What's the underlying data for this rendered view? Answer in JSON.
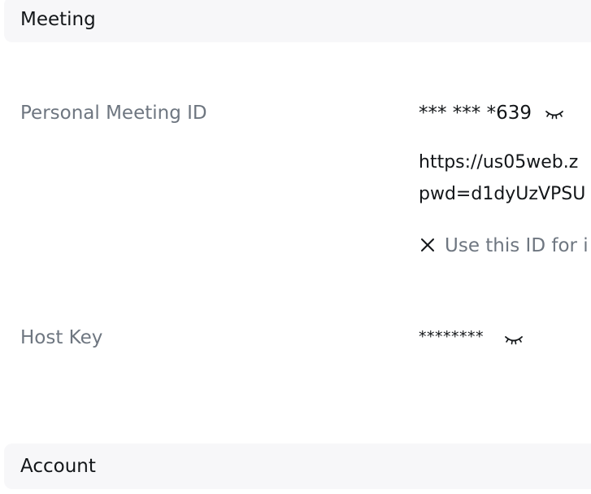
{
  "sections": {
    "meeting_title": "Meeting",
    "account_title": "Account"
  },
  "personal_meeting_id": {
    "label": "Personal Meeting ID",
    "masked_value": "*** *** *639",
    "link_line1": "https://us05web.z",
    "link_line2": "pwd=d1dyUzVPSU",
    "instant_option": "Use this ID for i",
    "icon": "eye-closed-icon"
  },
  "host_key": {
    "label": "Host Key",
    "masked_value": "********",
    "icon": "eye-closed-icon"
  },
  "colors": {
    "header_bg": "#f7f7f9",
    "label_text": "#6e7680",
    "value_text": "#131619"
  }
}
